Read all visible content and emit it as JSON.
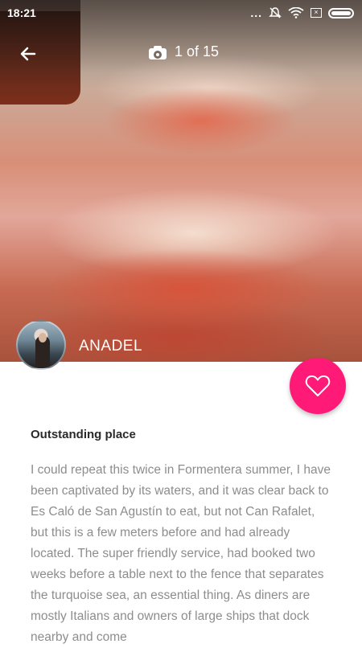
{
  "status_bar": {
    "time": "18:21",
    "dots": "...",
    "sim_icon": "x-sim-icon",
    "battery_icon": "battery-icon"
  },
  "toolbar": {
    "back_icon": "arrow-left-icon",
    "photo_counter": "1 of 15",
    "camera_icon": "camera-icon"
  },
  "author": {
    "name": "ANADEL"
  },
  "favorite": {
    "icon": "heart-icon",
    "color": "#ff1a77"
  },
  "review": {
    "title": "Outstanding place",
    "body": "I could repeat this twice in Formentera summer, I have been captivated by its waters, and it was clear back to Es Caló de San Agustín to eat, but not Can Rafalet, but this is a few meters before and had already located. The super friendly service, had booked two weeks before a table next to the fence that separates the turquoise sea, an essential thing. As diners are mostly Italians and owners of large ships that dock nearby and come"
  }
}
